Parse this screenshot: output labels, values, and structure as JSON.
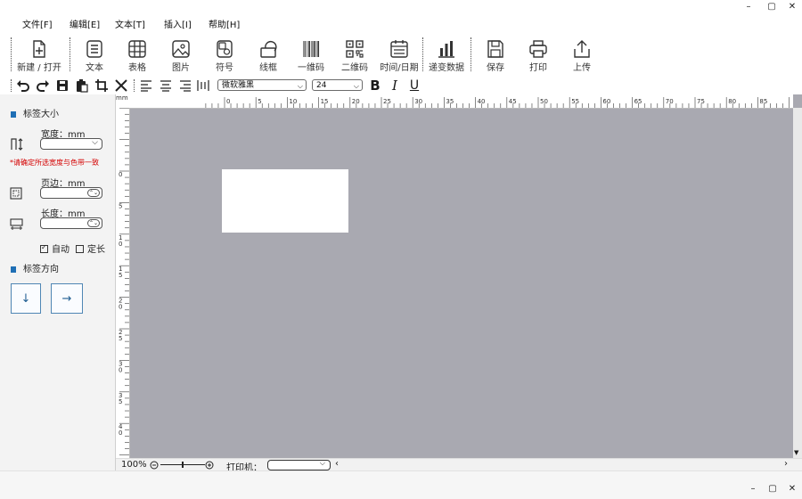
{
  "window": {
    "min": "–",
    "max": "▢",
    "close": "✕"
  },
  "menu": [
    "文件[F]",
    "编辑[E]",
    "文本[T]",
    "插入[I]",
    "帮助[H]"
  ],
  "toolbar": {
    "new_open": "新建 / 打开",
    "text": "文本",
    "table": "表格",
    "image": "图片",
    "symbol": "符号",
    "line": "线框",
    "barcode": "一维码",
    "qrcode": "二维码",
    "datetime": "时间/日期",
    "series": "递变数据",
    "save": "保存",
    "print": "打印",
    "upload": "上传"
  },
  "format": {
    "font": "微软雅黑",
    "size": "24",
    "bold": "B",
    "italic": "I",
    "underline": "U"
  },
  "panel": {
    "size_title": "标签大小",
    "width_label": "宽度：mm",
    "warning": "*请确定所选宽度与色带一致",
    "margin_label": "页边：mm",
    "length_label": "长度：mm",
    "auto_label": "自动",
    "fixed_label": "定长",
    "direction_title": "标签方向",
    "dir_down": "↓",
    "dir_right": "→"
  },
  "ruler": {
    "unit": "mm",
    "h_ticks": [
      "0",
      "5",
      "10",
      "15",
      "20",
      "25",
      "30",
      "35",
      "40",
      "45",
      "50",
      "55",
      "60",
      "65",
      "70",
      "75",
      "80",
      "85"
    ],
    "v_ticks": [
      "0",
      "5",
      "10",
      "15",
      "20",
      "25",
      "30",
      "35",
      "40"
    ]
  },
  "status": {
    "zoom": "100%",
    "printer_label": "打印机："
  },
  "bottom_window": {
    "min": "–",
    "max": "▢",
    "close": "✕"
  }
}
